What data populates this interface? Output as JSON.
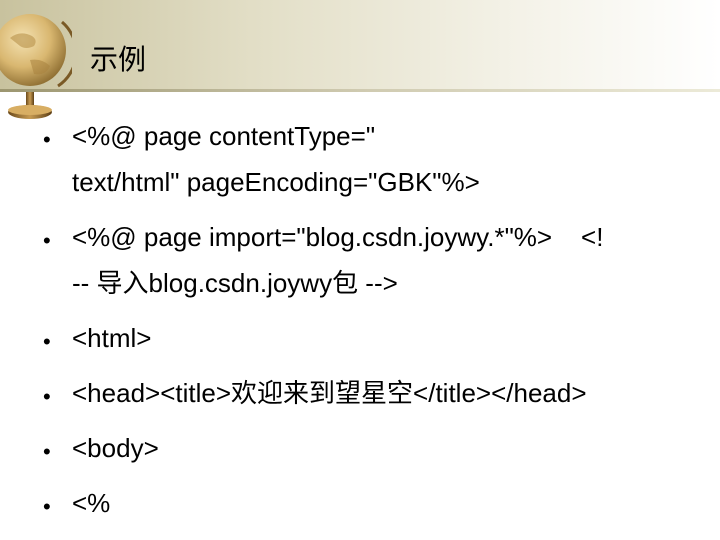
{
  "slide": {
    "title": "示例",
    "bullets": [
      {
        "lines": [
          "<%@ page contentType=\"",
          "text/html\" pageEncoding=\"GBK\"%>"
        ]
      },
      {
        "lines": [
          "<%@ page import=\"blog.csdn.joywy.*\"%>    <!",
          "-- 导入blog.csdn.joywy包 -->"
        ]
      },
      {
        "lines": [
          "<html>"
        ]
      },
      {
        "lines": [
          "<head><title>欢迎来到望星空</title></head>"
        ]
      },
      {
        "lines": [
          "<body>"
        ]
      },
      {
        "lines": [
          "<%"
        ]
      }
    ],
    "bullet_glyph": "•"
  },
  "decor": {
    "icon": "globe-icon"
  },
  "colors": {
    "header_band": "#c8c29e",
    "text": "#000000"
  }
}
